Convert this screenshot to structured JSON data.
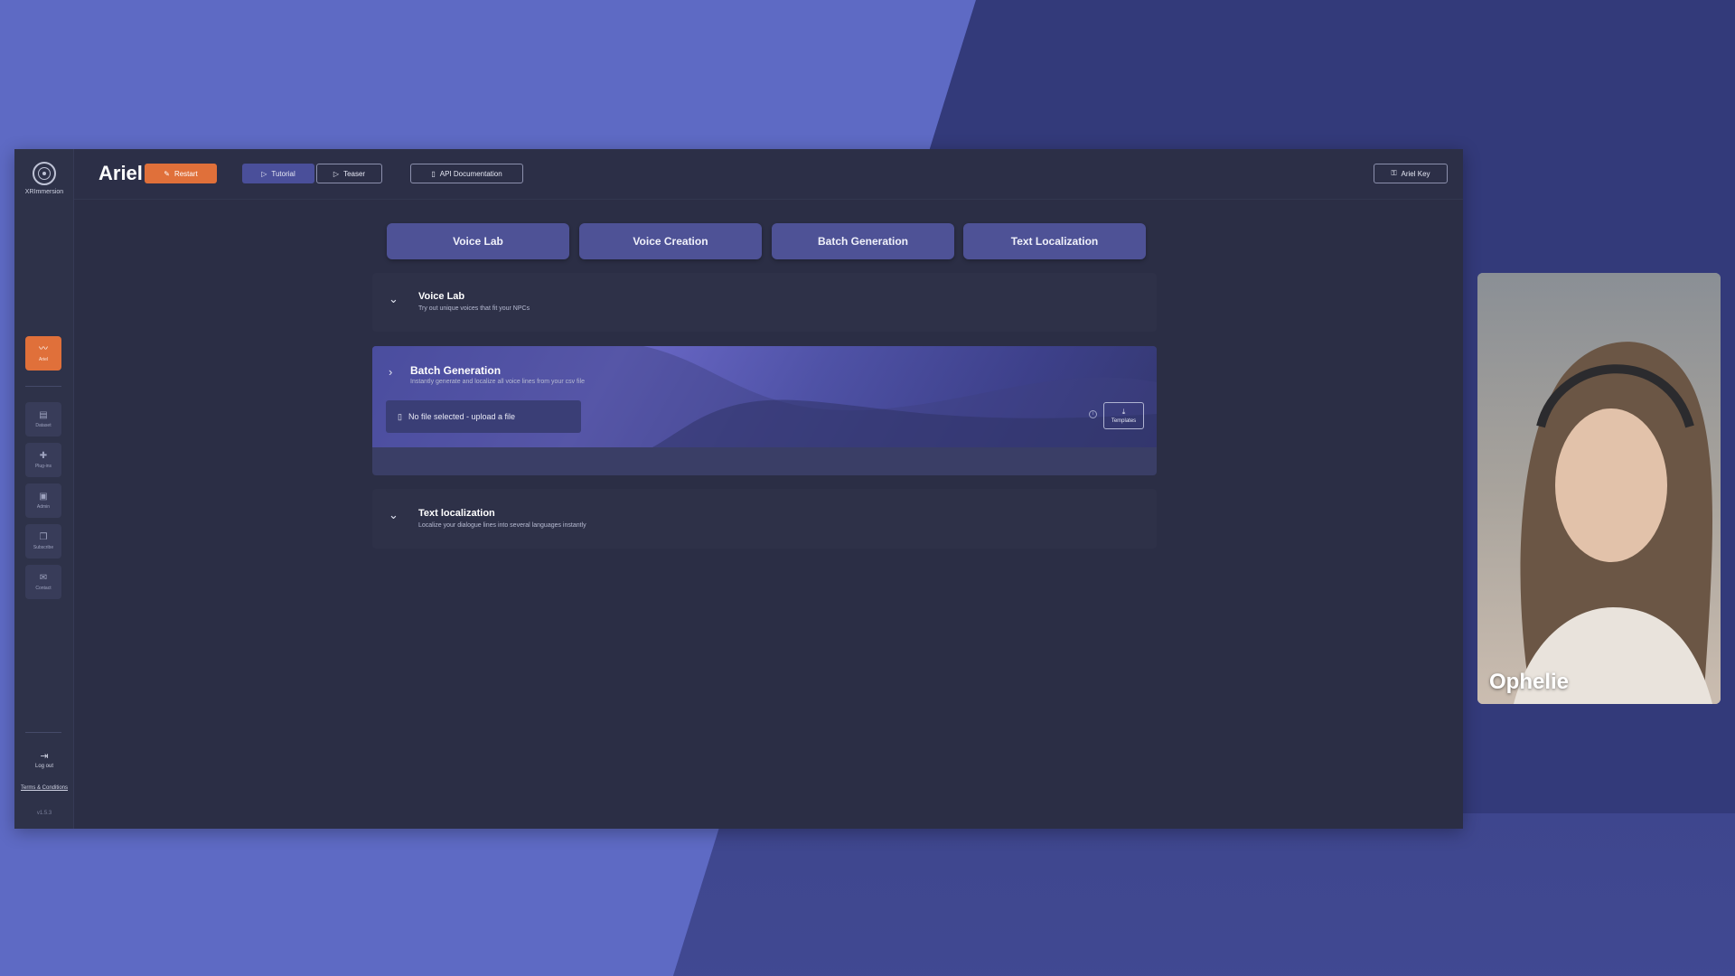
{
  "app": {
    "logo_text": "XRImmersion",
    "title": "Ariel"
  },
  "toolbar": {
    "restart_label": "Restart",
    "tutorial_label": "Tutorial",
    "teaser_label": "Teaser",
    "api_label": "API Documentation",
    "key_label": "Ariel Key"
  },
  "sidebar": {
    "items": [
      {
        "label": "Ariel",
        "icon": "waveform-icon",
        "active": true
      },
      {
        "label": "Dataset",
        "icon": "database-icon"
      },
      {
        "label": "Plug-ins",
        "icon": "puzzle-icon"
      },
      {
        "label": "Admin",
        "icon": "admin-icon"
      },
      {
        "label": "Subscribe",
        "icon": "subscribe-icon"
      },
      {
        "label": "Contact",
        "icon": "mail-icon"
      }
    ],
    "logout_label": "Log out",
    "terms_label": "Terms & Conditions",
    "version": "v1.5.3"
  },
  "tabs": [
    {
      "label": "Voice Lab"
    },
    {
      "label": "Voice Creation"
    },
    {
      "label": "Batch Generation"
    },
    {
      "label": "Text Localization"
    }
  ],
  "panels": {
    "voice_lab": {
      "title": "Voice Lab",
      "subtitle": "Try out unique voices that fit your NPCs"
    },
    "batch": {
      "title": "Batch Generation",
      "subtitle": "Instantly generate and localize all voice lines from your csv file",
      "file_placeholder": "No file selected - upload a file",
      "templates_label": "Templates"
    },
    "text_loc": {
      "title": "Text localization",
      "subtitle": "Localize your dialogue lines into several languages instantly"
    }
  },
  "webcam": {
    "name": "Ophelie"
  },
  "colors": {
    "accent_orange": "#e0703a",
    "tab_bg": "#4e5296",
    "app_bg": "#2b2e45"
  }
}
